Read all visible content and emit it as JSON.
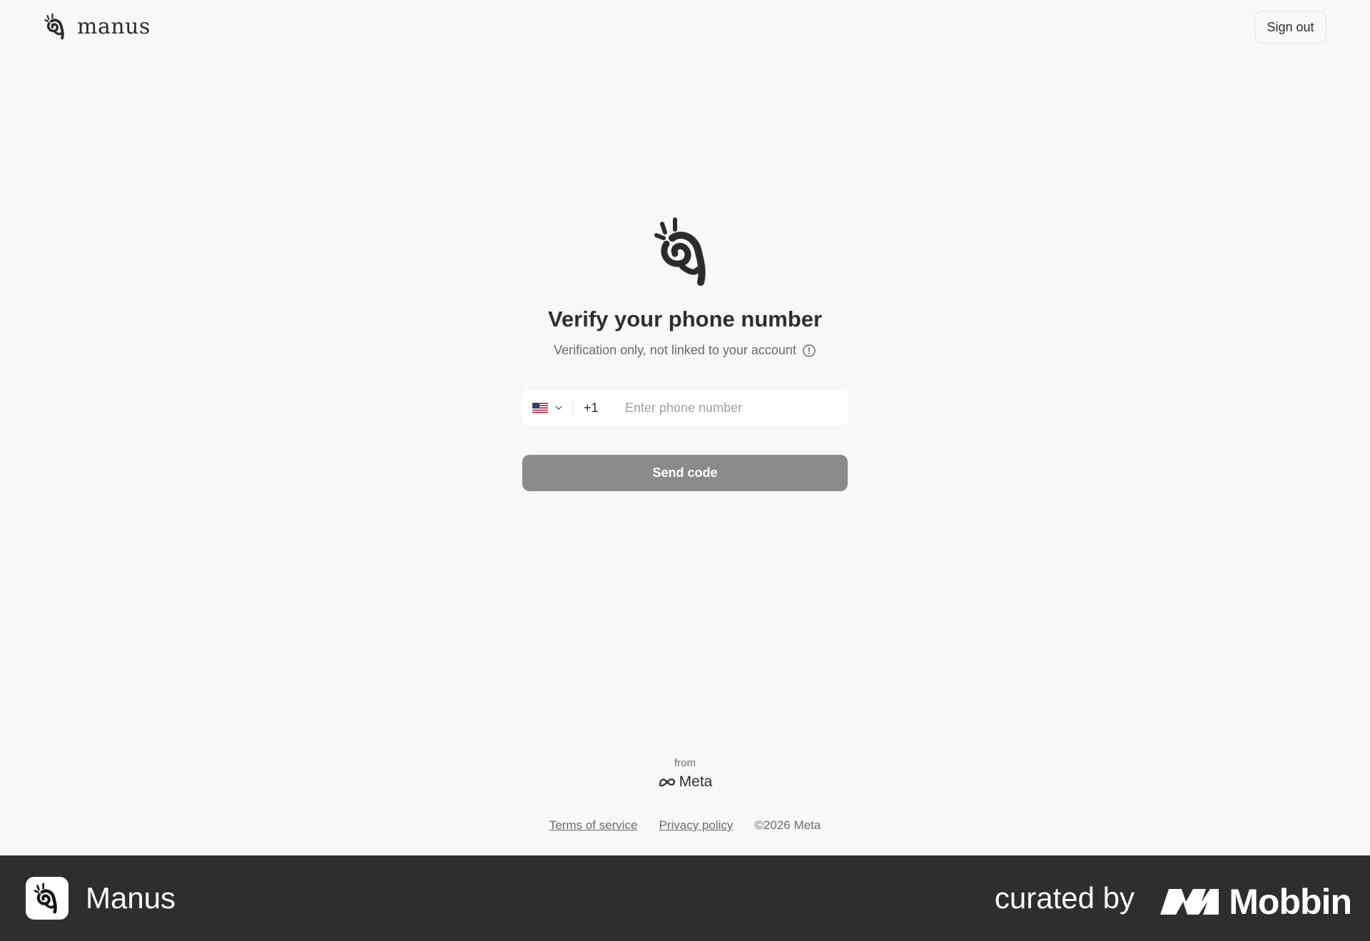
{
  "header": {
    "brand_name": "manus",
    "sign_out_label": "Sign out"
  },
  "verify": {
    "title": "Verify your phone number",
    "subtitle": "Verification only, not linked to your account",
    "country_flag": "us-flag-icon",
    "dial_code": "+1",
    "phone_value": "",
    "phone_placeholder": "Enter phone number",
    "send_label": "Send code"
  },
  "footer": {
    "from_label": "from",
    "meta_label": "Meta",
    "terms_label": "Terms of service",
    "privacy_label": "Privacy policy",
    "copyright": "©2026 Meta"
  },
  "watermark": {
    "app_name": "Manus",
    "curated_label": "curated by",
    "curator_name": "Mobbin"
  },
  "colors": {
    "background": "#f8f8f7",
    "button_disabled": "#8b8b8b",
    "bottom_bar": "#2e2e2e",
    "text_primary": "#2f2e2b",
    "text_secondary": "#6b6a66"
  }
}
